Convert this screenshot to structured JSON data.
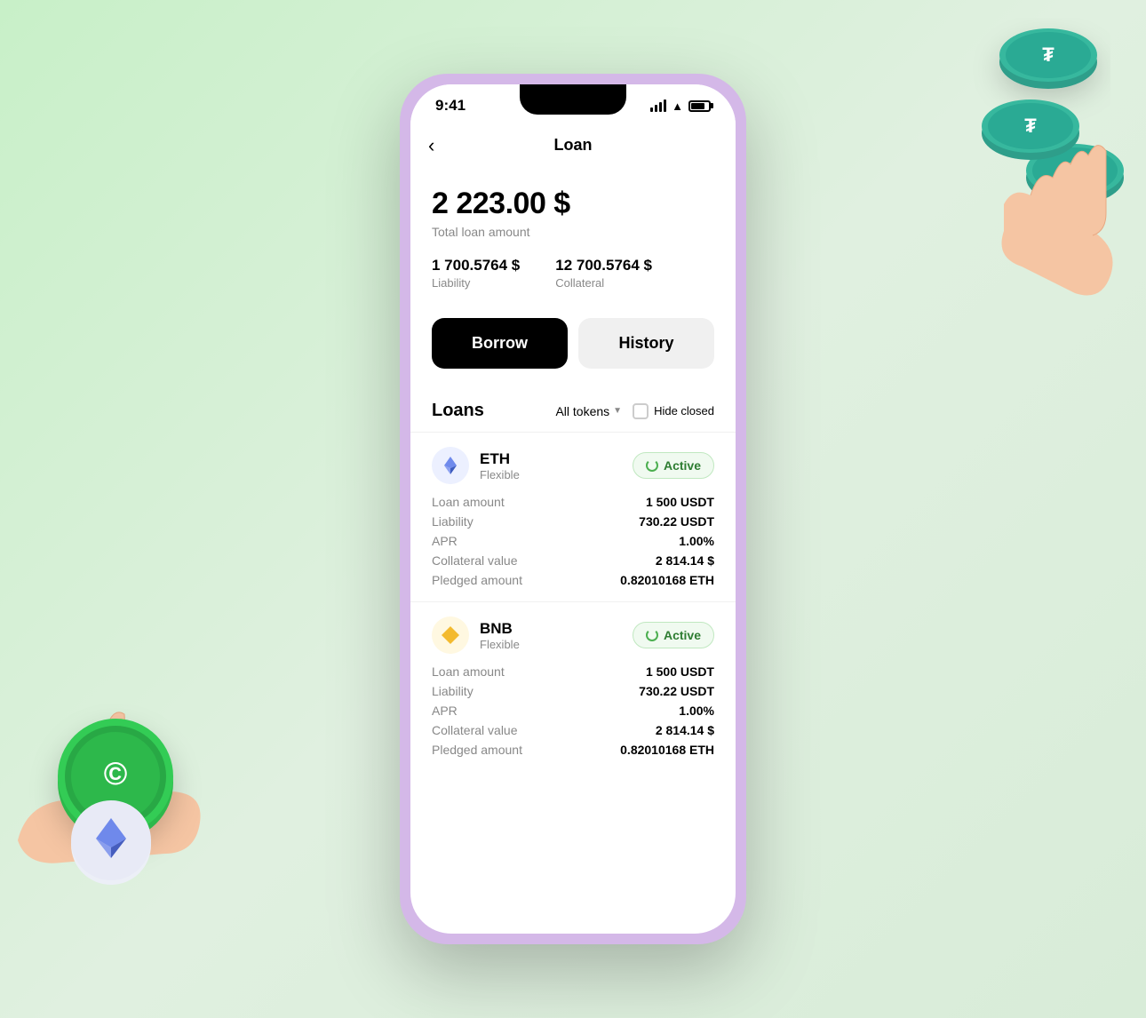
{
  "statusBar": {
    "time": "9:41",
    "battery": "80"
  },
  "header": {
    "title": "Loan",
    "backLabel": "‹"
  },
  "summary": {
    "totalAmount": "2 223.00 $",
    "totalLabel": "Total loan amount",
    "liability": {
      "value": "1 700.5764 $",
      "label": "Liability"
    },
    "collateral": {
      "value": "12 700.5764 $",
      "label": "Collateral"
    }
  },
  "tabs": {
    "borrow": "Borrow",
    "history": "History"
  },
  "loansSection": {
    "title": "Loans",
    "filter": "All tokens",
    "hideClosed": "Hide closed"
  },
  "loans": [
    {
      "coin": "ETH",
      "type": "Flexible",
      "status": "Active",
      "details": [
        {
          "label": "Loan amount",
          "value": "1 500 USDT"
        },
        {
          "label": "Liability",
          "value": "730.22 USDT"
        },
        {
          "label": "APR",
          "value": "1.00%"
        },
        {
          "label": "Collateral value",
          "value": "2 814.14 $"
        },
        {
          "label": "Pledged amount",
          "value": "0.82010168 ETH"
        }
      ]
    },
    {
      "coin": "BNB",
      "type": "Flexible",
      "status": "Active",
      "details": [
        {
          "label": "Loan amount",
          "value": "1 500 USDT"
        },
        {
          "label": "Liability",
          "value": "730.22 USDT"
        },
        {
          "label": "APR",
          "value": "1.00%"
        },
        {
          "label": "Collateral value",
          "value": "2 814.14 $"
        },
        {
          "label": "Pledged amount",
          "value": "0.82010168 ETH"
        }
      ]
    }
  ]
}
